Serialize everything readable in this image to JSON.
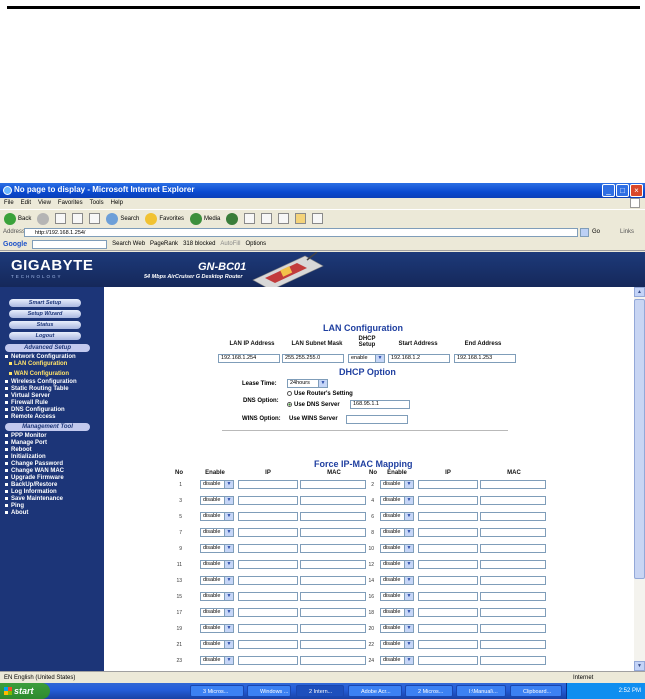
{
  "window": {
    "title": "No page to display - Microsoft Internet Explorer"
  },
  "menu": [
    "File",
    "Edit",
    "View",
    "Favorites",
    "Tools",
    "Help"
  ],
  "toolbar": {
    "back": "Back",
    "search": "Search",
    "favorites": "Favorites",
    "media": "Media"
  },
  "address": {
    "label": "Address",
    "url": "http://192.168.1.254/",
    "go": "Go",
    "links": "Links"
  },
  "googlebar": {
    "logo": "Google",
    "search_web": "Search Web",
    "pagerank": "PageRank",
    "blocked": "318 blocked",
    "autofill": "AutoFill",
    "options": "Options"
  },
  "header": {
    "brand": "GIGABYTE",
    "brand_sub": "TECHNOLOGY",
    "model": "GN-BC01",
    "model_sub": "54 Mbps AirCruiser G Desktop Router"
  },
  "sidebar": {
    "buttons": [
      "Smart Setup",
      "Setup Wizard",
      "Status",
      "Logout"
    ],
    "advanced_label": "Advanced Setup",
    "network": "Network Configuration",
    "lan": "LAN Configuration",
    "wan": "WAN Configuration",
    "advanced_items": [
      "Wireless Configuration",
      "Static Routing Table",
      "Virtual Server",
      "Firewall Rule",
      "DNS Configuration",
      "Remote Access"
    ],
    "management_label": "Management Tool",
    "management_items": [
      "PPP Monitor",
      "Manage Port",
      "Reboot",
      "Initialization",
      "Change Password",
      "Change WAN MAC",
      "Upgrade Firmware",
      "BackUp/Restore",
      "Log Information",
      "Save Maintenance",
      "Ping",
      "About"
    ]
  },
  "lan": {
    "title": "LAN Configuration",
    "headers": [
      "LAN IP Address",
      "LAN Subnet Mask",
      "DHCP Setup",
      "Start Address",
      "End Address"
    ],
    "ip": "192.168.1.254",
    "mask": "255.255.255.0",
    "dhcp": "enable",
    "start": "192.168.1.2",
    "end": "192.168.1.253"
  },
  "dhcp_option": {
    "title": "DHCP Option",
    "lease_label": "Lease Time:",
    "lease": "24hours",
    "dns_label": "DNS Option:",
    "use_router": "Use Router's Setting",
    "use_dns": "Use DNS Server",
    "dns_value": "168.95.1.1",
    "wins_label": "WINS Option:",
    "use_wins": "Use WINS Server",
    "wins_value": ""
  },
  "mapping": {
    "title": "Force IP-MAC Mapping",
    "headers": {
      "no": "No",
      "enable": "Enable",
      "ip": "IP",
      "mac": "MAC"
    },
    "default": "disable",
    "left": [
      "1",
      "3",
      "5",
      "7",
      "9",
      "11",
      "13",
      "15",
      "17",
      "19",
      "21",
      "23"
    ],
    "right": [
      "2",
      "4",
      "6",
      "8",
      "10",
      "12",
      "14",
      "16",
      "18",
      "20",
      "22",
      "24"
    ]
  },
  "status": {
    "lang": "EN English (United States)",
    "zone": "Internet"
  },
  "taskbar": {
    "start": "start",
    "tasks": [
      "3 Micros...",
      "Windows ...",
      "2 Intern...",
      "Adobe Acr...",
      "2 Micros...",
      "I:\\Manual\\...",
      "Clipboard..."
    ],
    "clock": "2:52 PM"
  }
}
